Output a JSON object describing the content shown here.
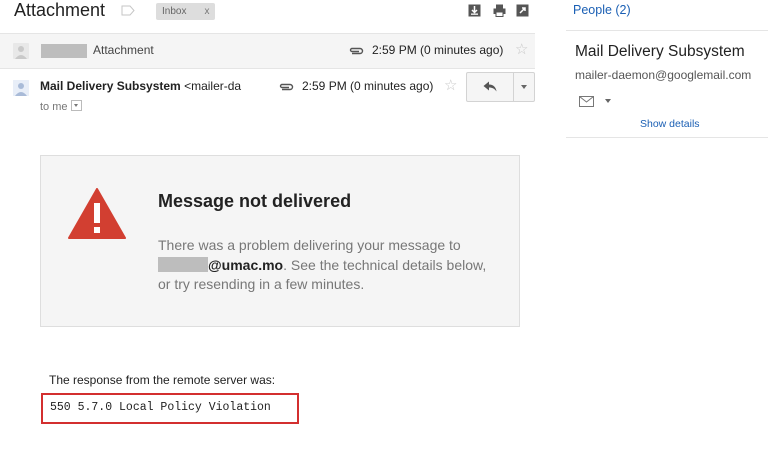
{
  "subject": "Attachment",
  "chip": {
    "label": "Inbox",
    "remove": "x"
  },
  "collapsed": {
    "label": "Attachment",
    "time": "2:59 PM (0 minutes ago)",
    "star": "☆"
  },
  "expanded": {
    "sender_name": "Mail Delivery Subsystem",
    "sender_addr": "<mailer-da",
    "to_me": "to me",
    "time": "2:59 PM (0 minutes ago)",
    "star": "☆"
  },
  "notice": {
    "title": "Message not delivered",
    "body_pre": "There was a problem delivering your message to",
    "domain": "@umac.mo",
    "body_post": ". See the technical details below, or try resending in a few minutes."
  },
  "response": {
    "label": "The response from the remote server was:",
    "code": "550 5.7.0 Local Policy Violation"
  },
  "people": {
    "header": "People (2)",
    "name": "Mail Delivery Subsystem",
    "email": "mailer-daemon@googlemail.com",
    "show_details": "Show details"
  },
  "colors": {
    "link": "#1a5fb4",
    "warning": "#d23f31",
    "highlight_box": "#d32f2f"
  },
  "icons": [
    "label-icon",
    "download-icon",
    "print-icon",
    "new-window-icon",
    "avatar-icon",
    "paperclip-icon",
    "star-icon",
    "reply-icon",
    "dropdown-icon",
    "warning-icon",
    "mail-icon"
  ]
}
